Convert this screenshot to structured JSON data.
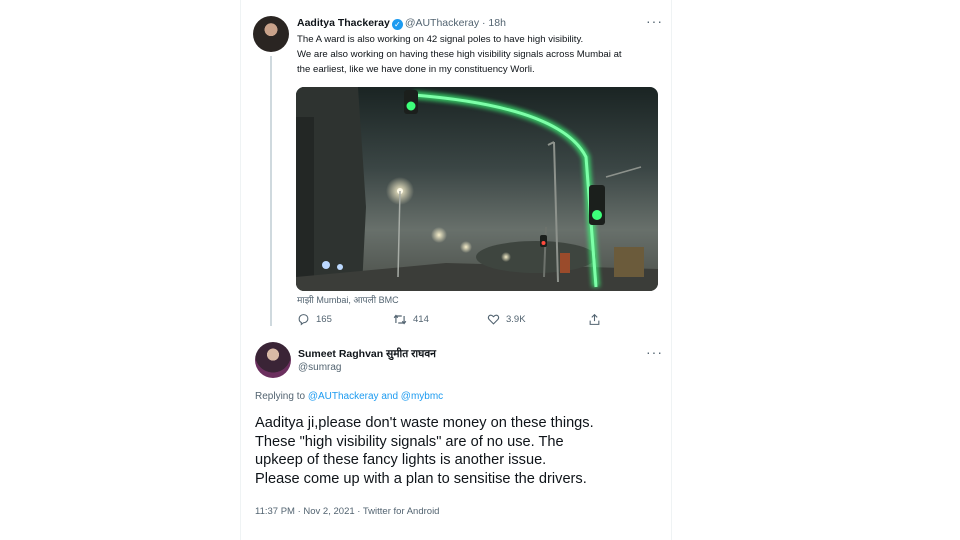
{
  "tweet1": {
    "author_name": "Aaditya Thackeray",
    "author_handle": "@AUThackeray",
    "separator": "·",
    "time": "18h",
    "more": "···",
    "text_lines": [
      "The A ward is also working on 42 signal poles to have high visibility.",
      "We are also working on having these high visibility signals across Mumbai at",
      "the earliest, like we have done in my constituency Worli."
    ],
    "media_caption": "माझी Mumbai, आपली BMC",
    "actions": {
      "replies": "165",
      "retweets": "414",
      "likes": "3.9K"
    },
    "icons": [
      "reply-icon",
      "retweet-icon",
      "like-icon",
      "share-icon"
    ]
  },
  "tweet2": {
    "author_name": "Sumeet Raghvan सुमीत राघवन",
    "author_handle": "@sumrag",
    "more": "···",
    "replying_prefix": "Replying to",
    "replying_user1": "@AUThackeray",
    "replying_and": "and",
    "replying_user2": "@mybmc",
    "text_lines": [
      "Aaditya ji,please don't waste money on these things.",
      "These \"high visibility signals\" are of no use. The",
      "upkeep of these fancy lights is another issue.",
      "Please come up with a plan to sensitise the drivers."
    ],
    "meta": "11:37 PM · Nov 2, 2021 · Twitter for Android"
  },
  "colors": {
    "accent": "#1d9bf0",
    "muted": "#536471",
    "signal_green": "#3dff7a"
  }
}
